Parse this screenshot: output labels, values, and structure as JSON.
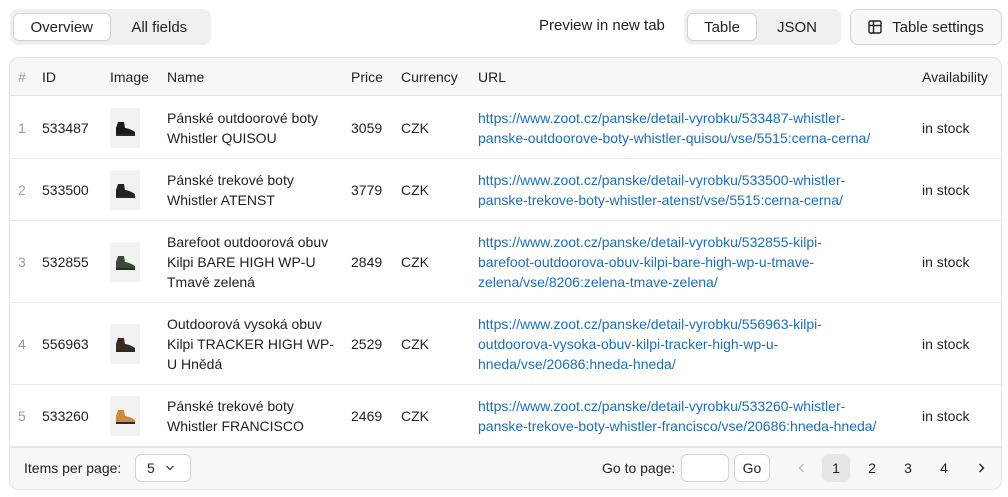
{
  "tabs": {
    "overview": "Overview",
    "all_fields": "All fields"
  },
  "toolbar": {
    "preview_link": "Preview in new tab",
    "view_table": "Table",
    "view_json": "JSON",
    "table_settings": "Table settings"
  },
  "table": {
    "headers": {
      "index": "#",
      "id": "ID",
      "image": "Image",
      "name": "Name",
      "price": "Price",
      "currency": "Currency",
      "url": "URL",
      "availability": "Availability"
    },
    "rows": [
      {
        "index": "1",
        "id": "533487",
        "name": [
          "Pánské outdoorové boty",
          "Whistler QUISOU"
        ],
        "price": "3059",
        "currency": "CZK",
        "url": [
          "https://www.zoot.cz/panske/detail-vyrobku/533487-whistler-",
          "panske-outdoorove-boty-whistler-quisou/vse/5515:cerna-cerna/"
        ],
        "availability": "in stock",
        "shoe_color": "#1a1a1a"
      },
      {
        "index": "2",
        "id": "533500",
        "name": [
          "Pánské trekové boty",
          "Whistler ATENST"
        ],
        "price": "3779",
        "currency": "CZK",
        "url": [
          "https://www.zoot.cz/panske/detail-vyrobku/533500-whistler-",
          "panske-trekove-boty-whistler-atenst/vse/5515:cerna-cerna/"
        ],
        "availability": "in stock",
        "shoe_color": "#222222"
      },
      {
        "index": "3",
        "id": "532855",
        "name": [
          "Barefoot outdoorová obuv",
          "Kilpi BARE HIGH WP-U",
          "Tmavě zelená"
        ],
        "price": "2849",
        "currency": "CZK",
        "url": [
          "https://www.zoot.cz/panske/detail-vyrobku/532855-kilpi-",
          "barefoot-outdoorova-obuv-kilpi-bare-high-wp-u-tmave-",
          "zelena/vse/8206:zelena-tmave-zelena/"
        ],
        "availability": "in stock",
        "shoe_color": "#3b4a36"
      },
      {
        "index": "4",
        "id": "556963",
        "name": [
          "Outdoorová vysoká obuv",
          "Kilpi TRACKER HIGH WP-",
          "U Hnědá"
        ],
        "price": "2529",
        "currency": "CZK",
        "url": [
          "https://www.zoot.cz/panske/detail-vyrobku/556963-kilpi-",
          "outdoorova-vysoka-obuv-kilpi-tracker-high-wp-u-",
          "hneda/vse/20686:hneda-hneda/"
        ],
        "availability": "in stock",
        "shoe_color": "#3a2a22"
      },
      {
        "index": "5",
        "id": "533260",
        "name": [
          "Pánské trekové boty",
          "Whistler FRANCISCO"
        ],
        "price": "2469",
        "currency": "CZK",
        "url": [
          "https://www.zoot.cz/panske/detail-vyrobku/533260-whistler-",
          "panske-trekove-boty-whistler-francisco/vse/20686:hneda-hneda/"
        ],
        "availability": "in stock",
        "shoe_color": "#c98a3a"
      }
    ]
  },
  "footer": {
    "items_per_page_label": "Items per page:",
    "items_per_page_value": "5",
    "goto_label": "Go to page:",
    "goto_value": "",
    "go_button": "Go",
    "pages": [
      "1",
      "2",
      "3",
      "4"
    ],
    "current_page": "1"
  },
  "colors": {
    "link": "#1a6fbf",
    "muted": "#9a9aa0",
    "border": "#e3e3e6",
    "header_bg": "#f7f7f8"
  }
}
